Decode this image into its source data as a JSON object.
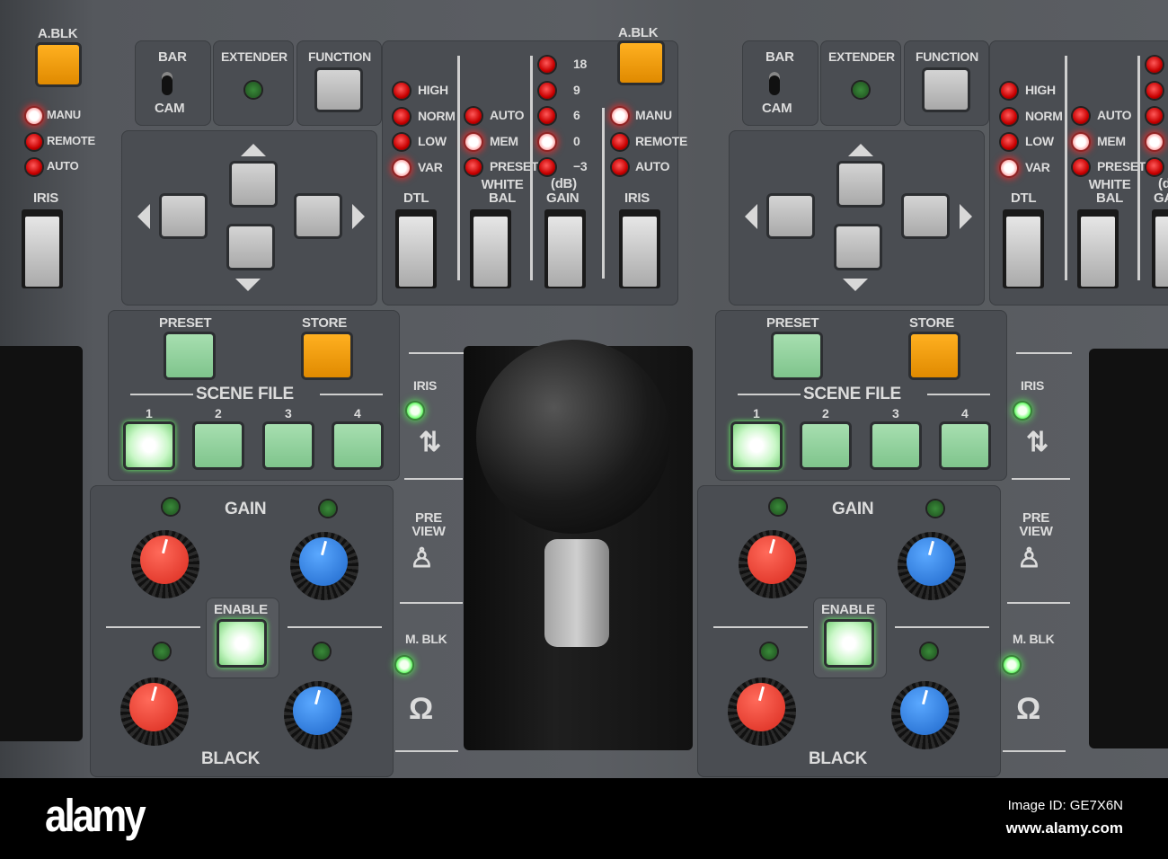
{
  "module": {
    "bar": "BAR",
    "cam": "CAM",
    "extender": "EXTENDER",
    "function": "FUNCTION",
    "a_blk": "A.BLK",
    "dtl": {
      "title": "DTL",
      "items": [
        "HIGH",
        "NORM",
        "LOW",
        "VAR"
      ],
      "lit": 3
    },
    "white_bal": {
      "title": "WHITE BAL",
      "items": [
        "AUTO",
        "MEM",
        "PRESET"
      ],
      "lit": 1
    },
    "gain": {
      "unit": "(dB)",
      "title": "GAIN",
      "items": [
        "18",
        "9",
        "6",
        "0",
        "−3"
      ],
      "lit": 3
    },
    "iris": {
      "title": "IRIS",
      "items": [
        "MANU",
        "REMOTE",
        "AUTO"
      ],
      "lit": 0
    },
    "preset": "PRESET",
    "store": "STORE",
    "scene_file": "SCENE FILE",
    "scenes": [
      "1",
      "2",
      "3",
      "4"
    ],
    "scene_lit": 0,
    "gain_label": "GAIN",
    "black_label": "BLACK",
    "enable": "ENABLE",
    "side_iris": "IRIS",
    "preview": "PRE VIEW",
    "m_blk": "M. BLK"
  },
  "colors": {
    "panel": "#4a4d52",
    "led_red": "#e01010",
    "led_green": "#66ff66",
    "store": "#f09a00",
    "knob_red": "#e0352a",
    "knob_blue": "#2a7be0"
  },
  "watermark": {
    "logo": "alamy",
    "image_id": "Image ID: GE7X6N",
    "url": "www.alamy.com"
  }
}
